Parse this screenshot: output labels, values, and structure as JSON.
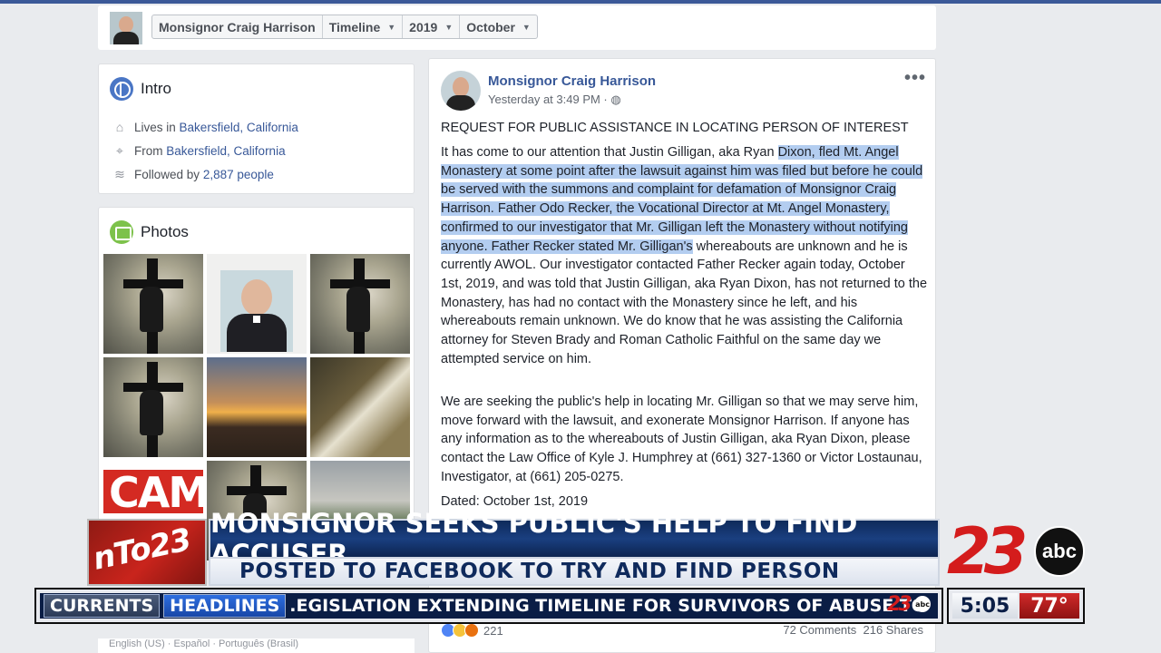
{
  "header": {
    "breadcrumbs": [
      {
        "label": "Monsignor Craig Harrison",
        "dropdown": false
      },
      {
        "label": "Timeline",
        "dropdown": true
      },
      {
        "label": "2019",
        "dropdown": true
      },
      {
        "label": "October",
        "dropdown": true
      }
    ]
  },
  "intro": {
    "title": "Intro",
    "lives_prefix": "Lives in ",
    "lives_link": "Bakersfield, California",
    "from_prefix": "From ",
    "from_link": "Bakersfield, California",
    "followed_prefix": "Followed by ",
    "followed_link": "2,887 people"
  },
  "photos": {
    "title": "Photos",
    "cam_text": "CAM"
  },
  "post": {
    "author": "Monsignor Craig Harrison",
    "time": "Yesterday at 3:49 PM · ",
    "more": "•••",
    "heading": "REQUEST FOR PUBLIC ASSISTANCE IN LOCATING PERSON OF INTEREST",
    "p1_a": "It has come to our attention that Justin Gilligan, aka Ryan ",
    "p1_hl": "Dixon, fled Mt. Angel Monastery at some point after the lawsuit against him was filed but before he could be served with the summons and complaint for defamation of Monsignor Craig Harrison. Father Odo Recker, the Vocational Director at Mt. Angel Monastery, confirmed to our investigator that Mr. Gilligan left the Monastery without notifying anyone. Father Recker stated Mr. Gilligan's",
    "p1_b": " whereabouts are unknown and he is currently AWOL. Our investigator contacted Father Recker again today, October 1st, 2019, and was told that Justin Gilligan, aka Ryan Dixon, has not returned to the Monastery, has had no contact with the Monastery since he left, and his whereabouts remain unknown. We do know that he was assisting the California attorney for Steven Brady and Roman Catholic Faithful on the same day we attempted service on him.",
    "p2": "We are seeking the public's help in locating Mr. Gilligan so that we may serve him, move forward with the lawsuit, and exonerate Monsignor Harrison. If anyone has any information as to the whereabouts of Justin Gilligan, aka Ryan Dixon, please contact the Law Office of Kyle J. Humphrey at (661) 327-1360 or Victor Lostaunau, Investigator, at (661) 205-0275.",
    "dated": "Dated: October 1st, 2019",
    "reaction_count": "221",
    "comments": "72 Comments",
    "shares": "216 Shares"
  },
  "footer": {
    "lang": "English (US) · Español · Português (Brasil)"
  },
  "broadcast": {
    "logo_text": "nTo23",
    "headline": "MONSIGNOR SEEKS PUBLIC'S HELP TO FIND ACCUSER",
    "subheadline": "POSTED TO FACEBOOK TO TRY AND FIND PERSON",
    "channel_number": "23",
    "network": "abc",
    "tag_currents": "CURRENTS",
    "tag_headlines": "HEADLINES",
    "crawl": ".EGISLATION EXTENDING TIMELINE FOR SURVIVORS OF ABUSE TO SUE",
    "time": "5:05",
    "temperature": "77°",
    "colors": {
      "brand_red": "#d41c1c",
      "navy": "#0a1d45",
      "facebook_blue": "#385898"
    }
  }
}
